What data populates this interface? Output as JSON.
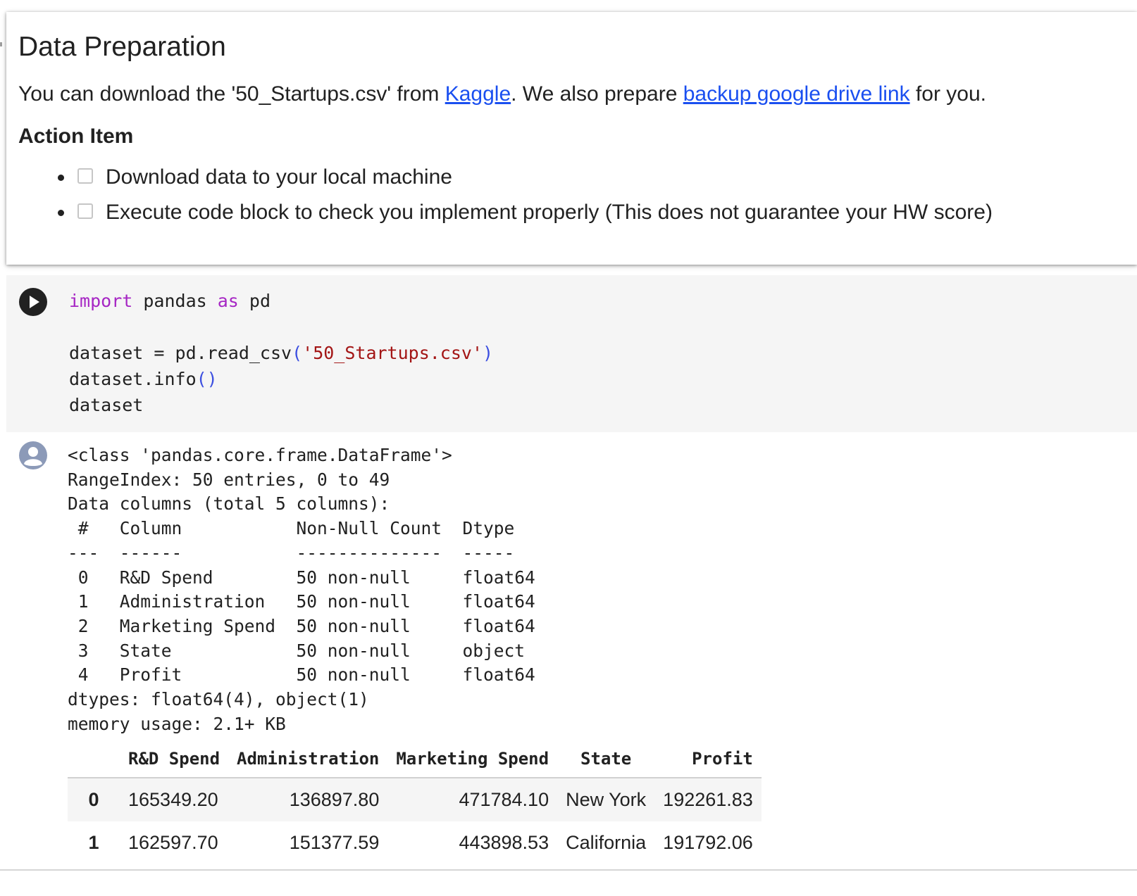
{
  "text_cell": {
    "heading": "Data Preparation",
    "intro_part1": "You can download the '50_Startups.csv' from ",
    "link_kaggle": "Kaggle",
    "intro_part2": ". We also prepare ",
    "link_backup": "backup google drive link",
    "intro_part3": " for you.",
    "subheading": "Action Item",
    "tasks": [
      {
        "label": "Download data to your local machine",
        "checked": false
      },
      {
        "label": "Execute code block to check you implement properly (This does not guarantee your HW score)",
        "checked": false
      }
    ]
  },
  "code_cell": {
    "line1_kw_import": "import",
    "line1_mid": " pandas ",
    "line1_kw_as": "as",
    "line1_end": " pd",
    "line3_start": "dataset = pd.read_csv",
    "line3_paren_open": "(",
    "line3_string": "'50_Startups.csv'",
    "line3_paren_close": ")",
    "line4_start": "dataset.info",
    "line4_parens": "()",
    "line5": "dataset"
  },
  "output": {
    "info_text": "<class 'pandas.core.frame.DataFrame'>\nRangeIndex: 50 entries, 0 to 49\nData columns (total 5 columns):\n #   Column           Non-Null Count  Dtype  \n---  ------           --------------  -----  \n 0   R&D Spend        50 non-null     float64\n 1   Administration   50 non-null     float64\n 2   Marketing Spend  50 non-null     float64\n 3   State            50 non-null     object \n 4   Profit           50 non-null     float64\ndtypes: float64(4), object(1)\nmemory usage: 2.1+ KB",
    "table": {
      "columns": [
        "",
        "R&D Spend",
        "Administration",
        "Marketing Spend",
        "State",
        "Profit"
      ],
      "rows": [
        {
          "index": "0",
          "rd_spend": "165349.20",
          "administration": "136897.80",
          "marketing_spend": "471784.10",
          "state": "New York",
          "profit": "192261.83"
        },
        {
          "index": "1",
          "rd_spend": "162597.70",
          "administration": "151377.59",
          "marketing_spend": "443898.53",
          "state": "California",
          "profit": "191792.06"
        }
      ]
    }
  }
}
